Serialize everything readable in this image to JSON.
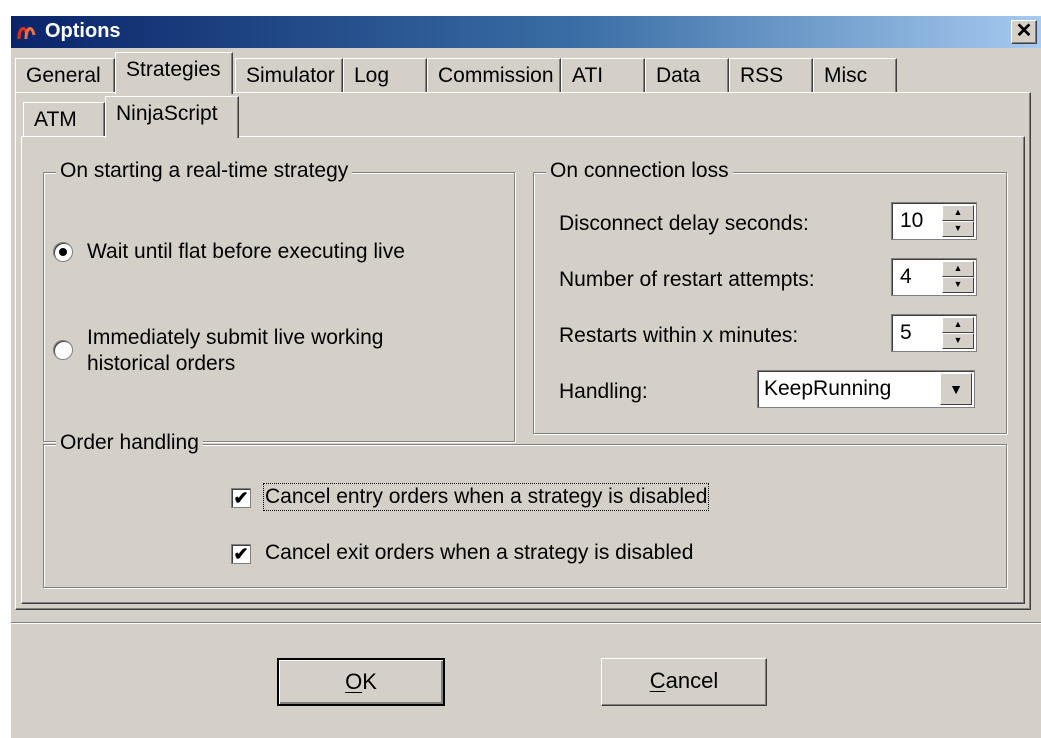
{
  "window": {
    "title": "Options",
    "close_glyph": "✕"
  },
  "tabs": [
    {
      "label": "General"
    },
    {
      "label": "Strategies"
    },
    {
      "label": "Simulator"
    },
    {
      "label": "Log"
    },
    {
      "label": "Commission"
    },
    {
      "label": "ATI"
    },
    {
      "label": "Data"
    },
    {
      "label": "RSS"
    },
    {
      "label": "Misc"
    }
  ],
  "active_tab": "Strategies",
  "subtabs": [
    {
      "label": "ATM"
    },
    {
      "label": "NinjaScript"
    }
  ],
  "active_subtab": "NinjaScript",
  "starting_group": {
    "title": "On starting a real-time strategy",
    "options": [
      {
        "label": "Wait until flat before executing live",
        "selected": true
      },
      {
        "label_line1": "Immediately submit live working",
        "label_line2": "historical orders",
        "selected": false
      }
    ]
  },
  "connection_group": {
    "title": "On connection loss",
    "fields": [
      {
        "label": "Disconnect delay seconds:",
        "value": "10"
      },
      {
        "label": "Number of restart attempts:",
        "value": "4"
      },
      {
        "label": "Restarts within x minutes:",
        "value": "5"
      }
    ],
    "handling": {
      "label": "Handling:",
      "value": "KeepRunning"
    }
  },
  "order_group": {
    "title": "Order handling",
    "checks": [
      {
        "label": "Cancel entry orders when a strategy is disabled",
        "checked": true
      },
      {
        "label": "Cancel exit orders when a strategy is disabled",
        "checked": true
      }
    ]
  },
  "buttons": {
    "ok": {
      "mnemonic": "O",
      "rest": "K"
    },
    "cancel": {
      "mnemonic": "C",
      "rest": "ancel"
    }
  },
  "glyphs": {
    "check": "✔",
    "spin_up": "▲",
    "spin_down": "▼",
    "dropdown": "▼"
  },
  "colors": {
    "dialog_face": "#d4d0c8",
    "titlebar_start": "#0a246a",
    "titlebar_end": "#a6caf0"
  }
}
